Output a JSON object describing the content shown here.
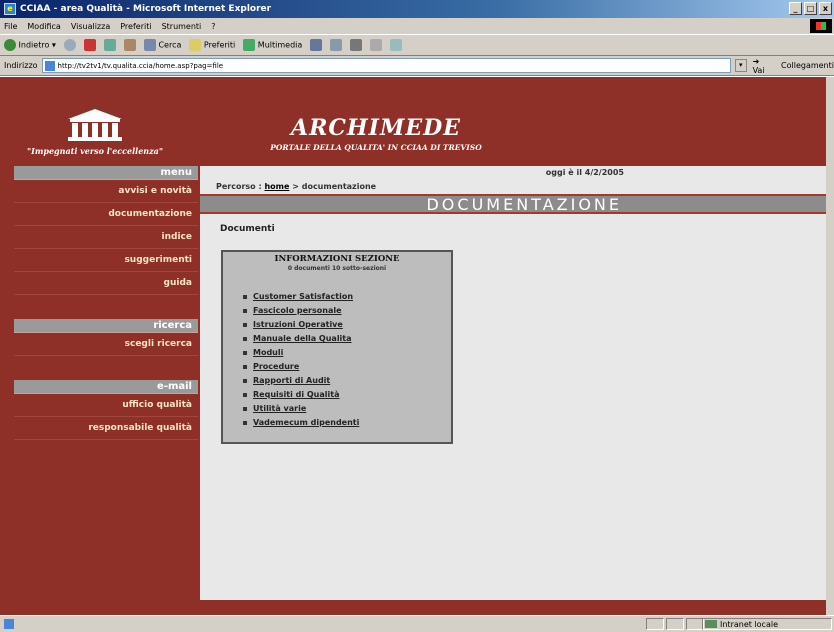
{
  "window": {
    "title": "CCIAA - area Qualità - Microsoft Internet Explorer",
    "controls": [
      "_",
      "□",
      "x"
    ]
  },
  "menubar": [
    "File",
    "Modifica",
    "Visualizza",
    "Preferiti",
    "Strumenti",
    "?"
  ],
  "toolbar": {
    "back": "Indietro",
    "search": "Cerca",
    "favorites": "Preferiti",
    "multimedia": "Multimedia"
  },
  "address": {
    "label": "Indirizzo",
    "url": "http://tv2tv1/tv.qualita.ccia/home.asp?pag=file",
    "go": "Vai",
    "links": "Collegamenti"
  },
  "header": {
    "tagline": "\"Impegnati verso l'eccellenza\"",
    "title": "ARCHIMEDE",
    "subtitle": "PORTALE DELLA QUALITA' IN CCIAA DI TREVISO"
  },
  "sidebar": {
    "menu_head": "menu",
    "menu_items": [
      "avvisi e novità",
      "documentazione",
      "indice",
      "suggerimenti",
      "guida"
    ],
    "search_head": "ricerca",
    "search_items": [
      "scegli ricerca"
    ],
    "email_head": "e-mail",
    "email_items": [
      "ufficio qualità",
      "responsabile qualità"
    ]
  },
  "content": {
    "date": "oggi è il 4/2/2005",
    "breadcrumb_prefix": "Percorso :",
    "breadcrumb_home": "home",
    "breadcrumb_sep": ">",
    "breadcrumb_current": "documentazione",
    "section_title": "DOCUMENTAZIONE",
    "doc_label": "Documenti",
    "info": {
      "title": "INFORMAZIONI SEZIONE",
      "subtitle": "0 documenti 10 sotto-sezioni",
      "links": [
        "Customer Satisfaction",
        "Fascicolo personale",
        "Istruzioni Operative",
        "Manuale della Qualita",
        "Moduli",
        "Procedure",
        "Rapporti di Audit",
        "Requisiti di Qualità",
        "Utilità varie",
        "Vademecum dipendenti"
      ]
    }
  },
  "statusbar": {
    "zone": "Intranet locale"
  },
  "colors": {
    "brand_red": "#8e3027",
    "sidebar_head": "#9a9a9a",
    "content_bg": "#e8e8e8"
  }
}
